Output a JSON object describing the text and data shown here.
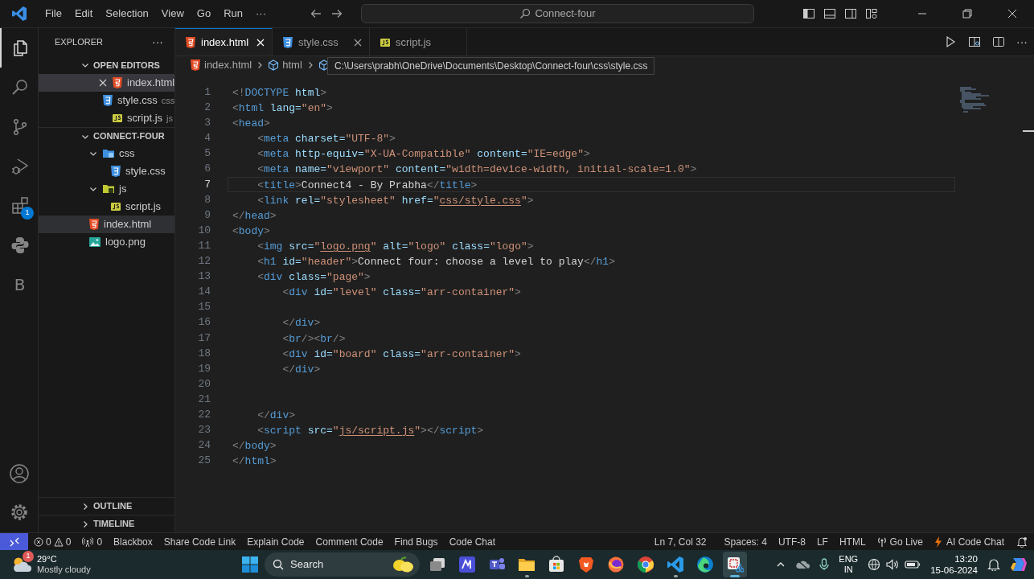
{
  "title_bar": {
    "menu": [
      "File",
      "Edit",
      "Selection",
      "View",
      "Go",
      "Run",
      "···"
    ],
    "search": "Connect-four"
  },
  "activity_bar": {
    "top": [
      {
        "kind": "explorer",
        "selected": true
      },
      {
        "kind": "search",
        "selected": false
      },
      {
        "kind": "source-control",
        "selected": false
      },
      {
        "kind": "run-debug",
        "selected": false
      },
      {
        "kind": "extensions",
        "selected": false,
        "badge": "1"
      },
      {
        "kind": "python",
        "selected": false
      },
      {
        "kind": "letter",
        "label": "B",
        "selected": false
      }
    ],
    "bottom": [
      {
        "kind": "account"
      },
      {
        "kind": "settings"
      }
    ]
  },
  "sidebar": {
    "title": "EXPLORER",
    "more": "···",
    "sections": [
      {
        "title": "OPEN EDITORS",
        "expanded": true,
        "kind": "open-editors",
        "items": [
          {
            "label": "index.html",
            "kind": "html",
            "selected": true,
            "close_visible": true
          },
          {
            "label": "style.css",
            "kind": "css",
            "description": "css",
            "selected": false,
            "close_visible": false
          },
          {
            "label": "script.js",
            "kind": "js",
            "description": "js",
            "selected": false,
            "close_visible": false
          }
        ]
      },
      {
        "title": "CONNECT-FOUR",
        "expanded": true,
        "kind": "tree",
        "items": [
          {
            "label": "css",
            "kind": "folder-css",
            "expanded": true,
            "selected": false,
            "children": [
              {
                "label": "style.css",
                "kind": "css",
                "selected": false
              }
            ]
          },
          {
            "label": "js",
            "kind": "folder-js",
            "expanded": true,
            "selected": false,
            "children": [
              {
                "label": "script.js",
                "kind": "js",
                "selected": false
              }
            ]
          },
          {
            "label": "index.html",
            "kind": "html",
            "selected": true
          },
          {
            "label": "logo.png",
            "kind": "image",
            "selected": false
          }
        ]
      },
      {
        "title": "OUTLINE",
        "expanded": false
      },
      {
        "title": "TIMELINE",
        "expanded": false
      }
    ]
  },
  "tabs": [
    {
      "label": "index.html",
      "kind": "html",
      "selected": true,
      "close_visible": true
    },
    {
      "label": "style.css",
      "kind": "css",
      "selected": false,
      "close_visible": true
    },
    {
      "label": "script.js",
      "kind": "js",
      "selected": false,
      "close_visible": false
    }
  ],
  "editor_actions": [
    {
      "kind": "run"
    },
    {
      "kind": "preview"
    },
    {
      "kind": "split"
    },
    {
      "kind": "more",
      "label": "···"
    }
  ],
  "breadcrumb": [
    {
      "kind": "html",
      "label": "index.html"
    },
    {
      "kind": "element",
      "label": "html"
    },
    {
      "kind": "element"
    }
  ],
  "tooltip": "C:\\Users\\prabh\\OneDrive\\Documents\\Desktop\\Connect-four\\css\\style.css",
  "editor": {
    "lines": [
      {
        "number": "1",
        "current": false,
        "tokens": [
          {
            "kind": "punct",
            "text": "<!"
          },
          {
            "kind": "tag",
            "text": "DOCTYPE "
          },
          {
            "kind": "attr",
            "text": "html"
          },
          {
            "kind": "punct",
            "text": ">"
          }
        ]
      },
      {
        "number": "2",
        "current": false,
        "tokens": [
          {
            "kind": "punct",
            "text": "<"
          },
          {
            "kind": "tag",
            "text": "html "
          },
          {
            "kind": "attr",
            "text": "lang="
          },
          {
            "kind": "string",
            "text": "\"en\""
          },
          {
            "kind": "punct",
            "text": ">"
          }
        ]
      },
      {
        "number": "3",
        "current": false,
        "tokens": [
          {
            "kind": "punct",
            "text": "<"
          },
          {
            "kind": "tag",
            "text": "head"
          },
          {
            "kind": "punct",
            "text": ">"
          }
        ]
      },
      {
        "number": "4",
        "current": false,
        "tokens": [
          {
            "kind": "punct",
            "text": "    <"
          },
          {
            "kind": "tag",
            "text": "meta "
          },
          {
            "kind": "attr",
            "text": "charset="
          },
          {
            "kind": "string",
            "text": "\"UTF-8\""
          },
          {
            "kind": "punct",
            "text": ">"
          }
        ]
      },
      {
        "number": "5",
        "current": false,
        "tokens": [
          {
            "kind": "punct",
            "text": "    <"
          },
          {
            "kind": "tag",
            "text": "meta "
          },
          {
            "kind": "attr",
            "text": "http-equiv="
          },
          {
            "kind": "string",
            "text": "\"X-UA-Compatible\" "
          },
          {
            "kind": "attr",
            "text": "content="
          },
          {
            "kind": "string",
            "text": "\"IE=edge\""
          },
          {
            "kind": "punct",
            "text": ">"
          }
        ]
      },
      {
        "number": "6",
        "current": false,
        "tokens": [
          {
            "kind": "punct",
            "text": "    <"
          },
          {
            "kind": "tag",
            "text": "meta "
          },
          {
            "kind": "attr",
            "text": "name="
          },
          {
            "kind": "string",
            "text": "\"viewport\" "
          },
          {
            "kind": "attr",
            "text": "content="
          },
          {
            "kind": "string",
            "text": "\"width=device-width, initial-scale=1.0\""
          },
          {
            "kind": "punct",
            "text": ">"
          }
        ]
      },
      {
        "number": "7",
        "current": true,
        "tokens": [
          {
            "kind": "punct",
            "text": "    <"
          },
          {
            "kind": "tag",
            "text": "title"
          },
          {
            "kind": "punct",
            "text": ">"
          },
          {
            "kind": "text",
            "text": "Connect4 - By Prabha"
          },
          {
            "kind": "punct",
            "text": "</"
          },
          {
            "kind": "tag",
            "text": "title"
          },
          {
            "kind": "punct",
            "text": ">"
          }
        ]
      },
      {
        "number": "8",
        "current": false,
        "tokens": [
          {
            "kind": "punct",
            "text": "    <"
          },
          {
            "kind": "tag",
            "text": "link "
          },
          {
            "kind": "attr",
            "text": "rel="
          },
          {
            "kind": "string",
            "text": "\"stylesheet\" "
          },
          {
            "kind": "attr",
            "text": "href="
          },
          {
            "kind": "string",
            "text": "\""
          },
          {
            "kind": "link",
            "text": "css/style.css"
          },
          {
            "kind": "string",
            "text": "\""
          },
          {
            "kind": "punct",
            "text": ">"
          }
        ]
      },
      {
        "number": "9",
        "current": false,
        "tokens": [
          {
            "kind": "punct",
            "text": "</"
          },
          {
            "kind": "tag",
            "text": "head"
          },
          {
            "kind": "punct",
            "text": ">"
          }
        ]
      },
      {
        "number": "10",
        "current": false,
        "tokens": [
          {
            "kind": "punct",
            "text": "<"
          },
          {
            "kind": "tag",
            "text": "body"
          },
          {
            "kind": "punct",
            "text": ">"
          }
        ]
      },
      {
        "number": "11",
        "current": false,
        "tokens": [
          {
            "kind": "punct",
            "text": "    <"
          },
          {
            "kind": "tag",
            "text": "img "
          },
          {
            "kind": "attr",
            "text": "src="
          },
          {
            "kind": "string",
            "text": "\""
          },
          {
            "kind": "link",
            "text": "logo.png"
          },
          {
            "kind": "string",
            "text": "\" "
          },
          {
            "kind": "attr",
            "text": "alt="
          },
          {
            "kind": "string",
            "text": "\"logo\" "
          },
          {
            "kind": "attr",
            "text": "class="
          },
          {
            "kind": "string",
            "text": "\"logo\""
          },
          {
            "kind": "punct",
            "text": ">"
          }
        ]
      },
      {
        "number": "12",
        "current": false,
        "tokens": [
          {
            "kind": "punct",
            "text": "    <"
          },
          {
            "kind": "tag",
            "text": "h1 "
          },
          {
            "kind": "attr",
            "text": "id="
          },
          {
            "kind": "string",
            "text": "\"header\""
          },
          {
            "kind": "punct",
            "text": ">"
          },
          {
            "kind": "text",
            "text": "Connect four: choose a level to play"
          },
          {
            "kind": "punct",
            "text": "</"
          },
          {
            "kind": "tag",
            "text": "h1"
          },
          {
            "kind": "punct",
            "text": ">"
          }
        ]
      },
      {
        "number": "13",
        "current": false,
        "tokens": [
          {
            "kind": "punct",
            "text": "    <"
          },
          {
            "kind": "tag",
            "text": "div "
          },
          {
            "kind": "attr",
            "text": "class="
          },
          {
            "kind": "string",
            "text": "\"page\""
          },
          {
            "kind": "punct",
            "text": ">"
          }
        ]
      },
      {
        "number": "14",
        "current": false,
        "tokens": [
          {
            "kind": "punct",
            "text": "        <"
          },
          {
            "kind": "tag",
            "text": "div "
          },
          {
            "kind": "attr",
            "text": "id="
          },
          {
            "kind": "string",
            "text": "\"level\" "
          },
          {
            "kind": "attr",
            "text": "class="
          },
          {
            "kind": "string",
            "text": "\"arr-container\""
          },
          {
            "kind": "punct",
            "text": ">"
          }
        ]
      },
      {
        "number": "15",
        "current": false
      },
      {
        "number": "16",
        "current": false,
        "tokens": [
          {
            "kind": "punct",
            "text": "        </"
          },
          {
            "kind": "tag",
            "text": "div"
          },
          {
            "kind": "punct",
            "text": ">"
          }
        ]
      },
      {
        "number": "17",
        "current": false,
        "tokens": [
          {
            "kind": "punct",
            "text": "        <"
          },
          {
            "kind": "tag",
            "text": "br"
          },
          {
            "kind": "punct",
            "text": "/><"
          },
          {
            "kind": "tag",
            "text": "br"
          },
          {
            "kind": "punct",
            "text": "/>"
          }
        ]
      },
      {
        "number": "18",
        "current": false,
        "tokens": [
          {
            "kind": "punct",
            "text": "        <"
          },
          {
            "kind": "tag",
            "text": "div "
          },
          {
            "kind": "attr",
            "text": "id="
          },
          {
            "kind": "string",
            "text": "\"board\" "
          },
          {
            "kind": "attr",
            "text": "class="
          },
          {
            "kind": "string",
            "text": "\"arr-container\""
          },
          {
            "kind": "punct",
            "text": ">"
          }
        ]
      },
      {
        "number": "19",
        "current": false,
        "tokens": [
          {
            "kind": "punct",
            "text": "        </"
          },
          {
            "kind": "tag",
            "text": "div"
          },
          {
            "kind": "punct",
            "text": ">"
          }
        ]
      },
      {
        "number": "20",
        "current": false
      },
      {
        "number": "21",
        "current": false
      },
      {
        "number": "22",
        "current": false,
        "tokens": [
          {
            "kind": "punct",
            "text": "    </"
          },
          {
            "kind": "tag",
            "text": "div"
          },
          {
            "kind": "punct",
            "text": ">"
          }
        ]
      },
      {
        "number": "23",
        "current": false,
        "tokens": [
          {
            "kind": "punct",
            "text": "    <"
          },
          {
            "kind": "tag",
            "text": "script "
          },
          {
            "kind": "attr",
            "text": "src="
          },
          {
            "kind": "string",
            "text": "\""
          },
          {
            "kind": "link",
            "text": "js/script.js"
          },
          {
            "kind": "string",
            "text": "\""
          },
          {
            "kind": "punct",
            "text": "></"
          },
          {
            "kind": "tag",
            "text": "script"
          },
          {
            "kind": "punct",
            "text": ">"
          }
        ]
      },
      {
        "number": "24",
        "current": false,
        "tokens": [
          {
            "kind": "punct",
            "text": "</"
          },
          {
            "kind": "tag",
            "text": "body"
          },
          {
            "kind": "punct",
            "text": ">"
          }
        ]
      },
      {
        "number": "25",
        "current": false,
        "tokens": [
          {
            "kind": "punct",
            "text": "</"
          },
          {
            "kind": "tag",
            "text": "html"
          },
          {
            "kind": "punct",
            "text": ">"
          }
        ]
      }
    ]
  },
  "status_bar": {
    "left": [
      {
        "kind": "remote"
      },
      {
        "kind": "problems",
        "errors": "0",
        "warnings": "0"
      },
      {
        "kind": "ports",
        "label": "0"
      },
      {
        "kind": "text",
        "label": "Blackbox"
      },
      {
        "kind": "text",
        "label": "Share Code Link"
      },
      {
        "kind": "text",
        "label": "Explain Code"
      },
      {
        "kind": "text",
        "label": "Comment Code"
      },
      {
        "kind": "text",
        "label": "Find Bugs"
      },
      {
        "kind": "text",
        "label": "Code Chat"
      }
    ],
    "right": [
      {
        "kind": "text",
        "label": "Ln 7, Col 32"
      },
      {
        "kind": "text",
        "label": "Spaces: 4"
      },
      {
        "kind": "text",
        "label": "UTF-8"
      },
      {
        "kind": "text",
        "label": "LF"
      },
      {
        "kind": "text",
        "label": "HTML"
      },
      {
        "kind": "go-live",
        "label": "Go Live"
      },
      {
        "kind": "ai",
        "label": "AI Code Chat"
      },
      {
        "kind": "bell"
      }
    ]
  },
  "taskbar": {
    "weather": {
      "badge": "1",
      "temperature": "29°C",
      "condition": "Mostly cloudy"
    },
    "search": "Search",
    "apps": [
      {
        "kind": "task-view",
        "running": false,
        "selected": false
      },
      {
        "kind": "m-app",
        "running": false,
        "selected": false
      },
      {
        "kind": "chat",
        "running": false,
        "selected": false
      },
      {
        "kind": "folder",
        "running": true,
        "selected": false
      },
      {
        "kind": "store",
        "running": false,
        "selected": false
      },
      {
        "kind": "shield",
        "running": false,
        "selected": false
      },
      {
        "kind": "fox",
        "running": false,
        "selected": false
      },
      {
        "kind": "chrome",
        "running": false,
        "selected": false
      },
      {
        "kind": "code",
        "running": true,
        "selected": false
      },
      {
        "kind": "edge",
        "running": false,
        "selected": false
      },
      {
        "kind": "snip",
        "running": true,
        "selected": true
      }
    ],
    "language": "ENG",
    "region": "IN",
    "time": "13:20",
    "date": "15-06-2024"
  }
}
